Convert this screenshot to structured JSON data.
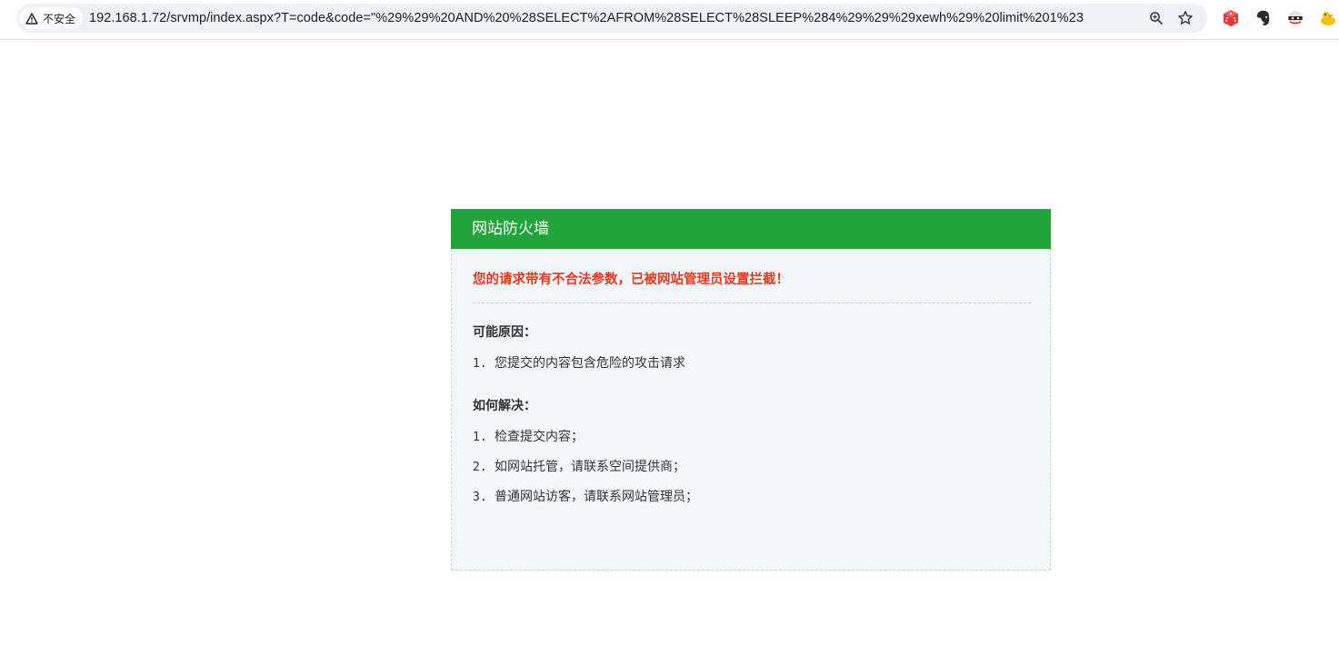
{
  "browser": {
    "security_label": "不安全",
    "url": "192.168.1.72/srvmp/index.aspx?T=code&code=\"%29%29%20AND%20%28SELECT%2AFROM%28SELECT%28SLEEP%284%29%29%29xewh%29%20limit%201%23",
    "icons": [
      "warning-icon",
      "zoom-icon",
      "star-icon",
      "dice-extension-icon",
      "evernote-extension-icon",
      "mask-extension-icon",
      "duck-extension-icon"
    ]
  },
  "firewall": {
    "title": "网站防火墙",
    "alert": "您的请求带有不合法参数，已被网站管理员设置拦截！",
    "reasons_title": "可能原因：",
    "reasons": [
      {
        "num": "1.",
        "text": "您提交的内容包含危险的攻击请求"
      }
    ],
    "solutions_title": "如何解决：",
    "solutions": [
      {
        "num": "1.",
        "text": "检查提交内容；"
      },
      {
        "num": "2.",
        "text": "如网站托管，请联系空间提供商；"
      },
      {
        "num": "3.",
        "text": "普通网站访客，请联系网站管理员；"
      }
    ]
  },
  "colors": {
    "header_green": "#21a53b",
    "alert_red": "#e8381e",
    "body_bg": "#f3f6f8"
  }
}
